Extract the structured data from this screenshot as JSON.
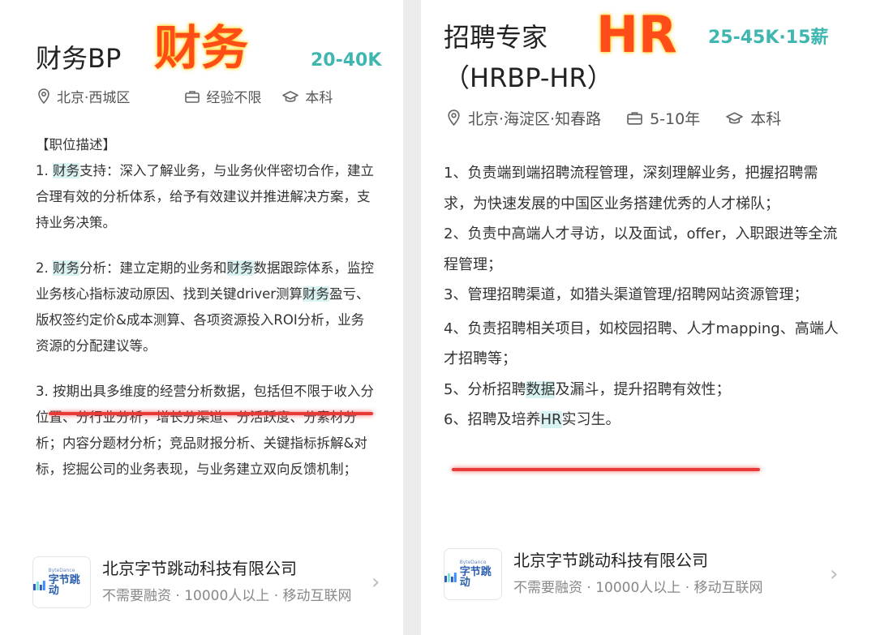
{
  "left": {
    "title": "财务BP",
    "overlay": "财务",
    "salary": "20-40K",
    "location": "北京·西城区",
    "experience": "经验不限",
    "degree": "本科",
    "section_heading": "【职位描述】",
    "item1": {
      "pre": "1. ",
      "hl": "财务",
      "post": "支持：深入了解业务，与业务伙伴密切合作，建立合理有效的分析体系，给予有效建议并推进解决方案，支持业务决策。"
    },
    "item2": {
      "pre": "2. ",
      "hl1": "财务",
      "mid1": "分析：建立定期的业务和",
      "hl2": "财务",
      "mid2": "数据跟踪体系，监控业务核心指标波动原因、找到关键driver测算",
      "hl3": "财务",
      "post": "盈亏、版权签约定价&成本测算、各项资源投入ROI分析，业务资源的分配建议等。"
    },
    "item3": "3. 按期出具多维度的经营分析数据，包括但不限于收入分位置、分行业分析；增长分渠道、分活跃度、分素材分析；内容分题材分析；竞品财报分析、关键指标拆解&对标，挖掘公司的业务表现，与业务建立双向反馈机制；",
    "company": {
      "logo_small": "ByteDance",
      "logo_text": "字节跳动",
      "name": "北京字节跳动科技有限公司",
      "sub": "不需要融资 · 10000人以上 · 移动互联网"
    }
  },
  "right": {
    "title": "招聘专家",
    "title2": "（HRBP-HR）",
    "overlay": "HR",
    "salary": "25-45K·15薪",
    "location": "北京·海淀区·知春路",
    "experience": "5-10年",
    "degree": "本科",
    "item1": "1、负责端到端招聘流程管理，深刻理解业务，把握招聘需求，为快速发展的中国区业务搭建优秀的人才梯队；",
    "item2": "2、负责中高端人才寻访，以及面试，offer，入职跟进等全流程管理；",
    "item3": "3、管理招聘渠道，如猎头渠道管理/招聘网站资源管理；",
    "item4": "4、负责招聘相关项目，如校园招聘、人才mapping、高端人才招聘等；",
    "item5": {
      "pre": "5、分析招聘",
      "hl": "数据",
      "post": "及漏斗，提升招聘有效性；"
    },
    "item6": {
      "pre": "6、招聘及培养",
      "hl": "HR",
      "post": "实习生。"
    },
    "company": {
      "logo_small": "ByteDance",
      "logo_text": "字节跳动",
      "name": "北京字节跳动科技有限公司",
      "sub": "不需要融资 · 10000人以上 · 移动互联网"
    }
  },
  "colors": {
    "salary": "#3fb6b0",
    "overlay": "#ff4d1a",
    "highlight": "#d9f3f2",
    "underline": "#e93a3a"
  }
}
